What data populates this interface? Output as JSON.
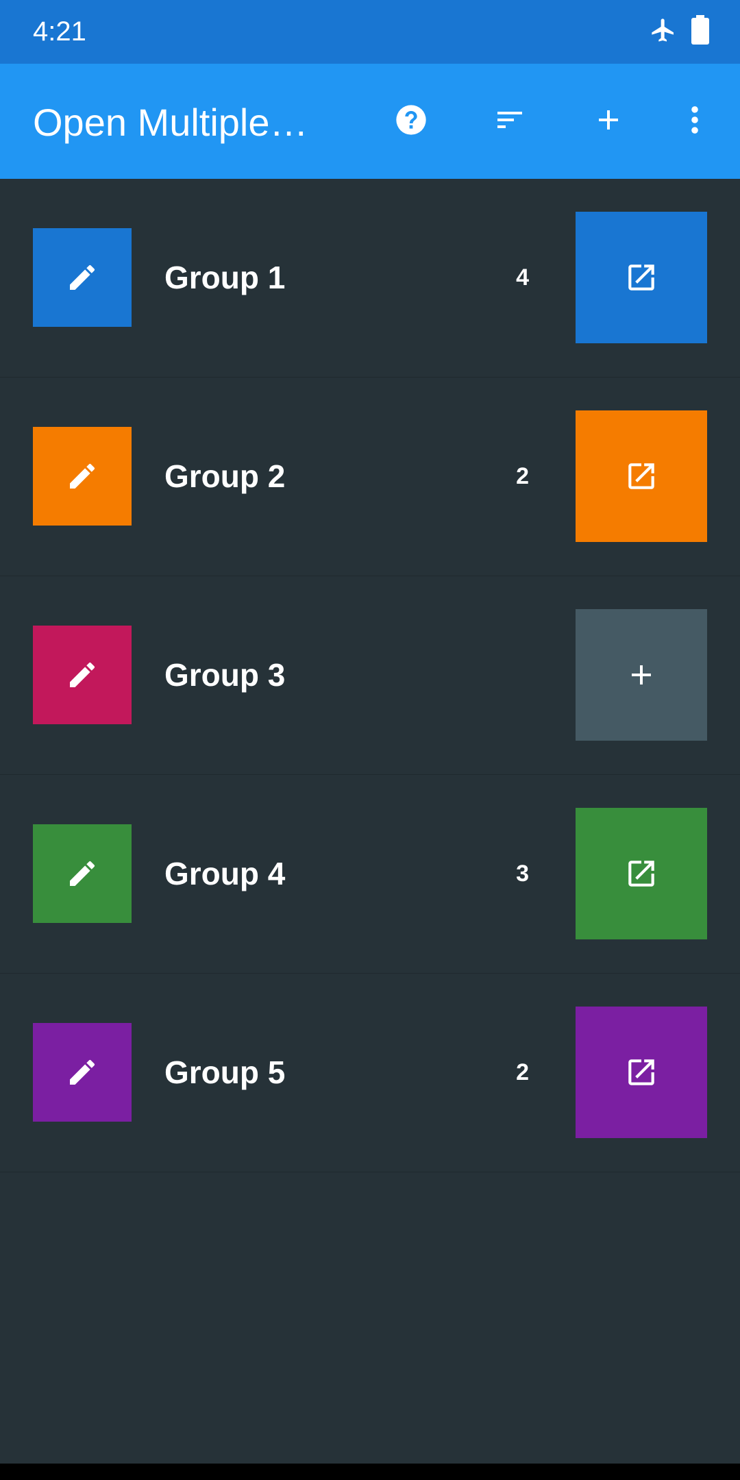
{
  "status_bar": {
    "time": "4:21",
    "icons": [
      "airplane-mode-icon",
      "battery-icon"
    ]
  },
  "app_bar": {
    "title": "Open Multiple…",
    "actions": [
      "help-icon",
      "sort-icon",
      "add-icon",
      "more-vert-icon"
    ]
  },
  "groups": [
    {
      "name": "Group 1",
      "count": "4",
      "color": "#1976d2",
      "action": "open"
    },
    {
      "name": "Group 2",
      "count": "2",
      "color": "#f57c00",
      "action": "open"
    },
    {
      "name": "Group 3",
      "count": "",
      "color": "#c2185b",
      "action": "add",
      "action_color": "#455a64"
    },
    {
      "name": "Group 4",
      "count": "3",
      "color": "#388e3c",
      "action": "open"
    },
    {
      "name": "Group 5",
      "count": "2",
      "color": "#7b1fa2",
      "action": "open"
    }
  ],
  "colors": {
    "status_bar": "#1976d2",
    "app_bar": "#2196f3",
    "background": "#263238"
  }
}
